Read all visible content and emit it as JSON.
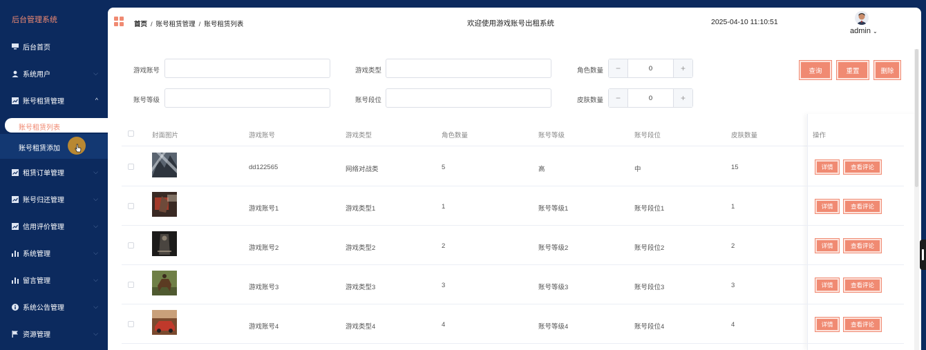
{
  "sidebar": {
    "brand": "后台管理系统",
    "items": [
      {
        "label": "后台首页",
        "icon": "monitor-icon"
      },
      {
        "label": "系统用户",
        "icon": "user-icon"
      },
      {
        "label": "账号租赁管理",
        "icon": "chart-box-icon"
      }
    ],
    "sub_items": [
      {
        "label": "账号租赁列表",
        "active": true
      },
      {
        "label": "账号租赁添加",
        "active": false
      }
    ],
    "items_after": [
      {
        "label": "租赁订单管理",
        "icon": "chart-box-icon"
      },
      {
        "label": "账号归还管理",
        "icon": "chart-box-icon"
      },
      {
        "label": "信用评价管理",
        "icon": "chart-box-icon"
      },
      {
        "label": "系统管理",
        "icon": "bar-chart-icon"
      },
      {
        "label": "留言管理",
        "icon": "bar-chart-icon"
      },
      {
        "label": "系统公告管理",
        "icon": "info-icon"
      },
      {
        "label": "资源管理",
        "icon": "flag-icon"
      }
    ]
  },
  "header": {
    "breadcrumb": [
      "首页",
      "账号租赁管理",
      "账号租赁列表"
    ],
    "welcome": "欢迎使用游戏账号出租系统",
    "datetime": "2025-04-10 11:10:51",
    "user": "admin"
  },
  "search": {
    "account_label": "游戏账号",
    "type_label": "游戏类型",
    "role_count_label": "角色数量",
    "role_count_value": "0",
    "level_label": "账号等级",
    "rank_label": "账号段位",
    "skin_count_label": "皮肤数量",
    "skin_count_value": "0",
    "minus": "−",
    "plus": "+",
    "query_button": "查询",
    "reset_button": "重置",
    "delete_button": "删除"
  },
  "table": {
    "headers": [
      "封面图片",
      "游戏账号",
      "游戏类型",
      "角色数量",
      "账号等级",
      "账号段位",
      "皮肤数量",
      "操作"
    ],
    "detail_button": "详情",
    "review_button": "查看评论",
    "rows": [
      {
        "account": "dd122565",
        "type": "网络对战类",
        "roles": "5",
        "level": "高",
        "rank": "中",
        "skins": "15"
      },
      {
        "account": "游戏账号1",
        "type": "游戏类型1",
        "roles": "1",
        "level": "账号等级1",
        "rank": "账号段位1",
        "skins": "1"
      },
      {
        "account": "游戏账号2",
        "type": "游戏类型2",
        "roles": "2",
        "level": "账号等级2",
        "rank": "账号段位2",
        "skins": "2"
      },
      {
        "account": "游戏账号3",
        "type": "游戏类型3",
        "roles": "3",
        "level": "账号等级3",
        "rank": "账号段位3",
        "skins": "3"
      },
      {
        "account": "游戏账号4",
        "type": "游戏类型4",
        "roles": "4",
        "level": "账号等级4",
        "rank": "账号段位4",
        "skins": "4"
      }
    ]
  },
  "colors": {
    "accent": "#f08a72",
    "sidebar": "#0c2a5e"
  }
}
